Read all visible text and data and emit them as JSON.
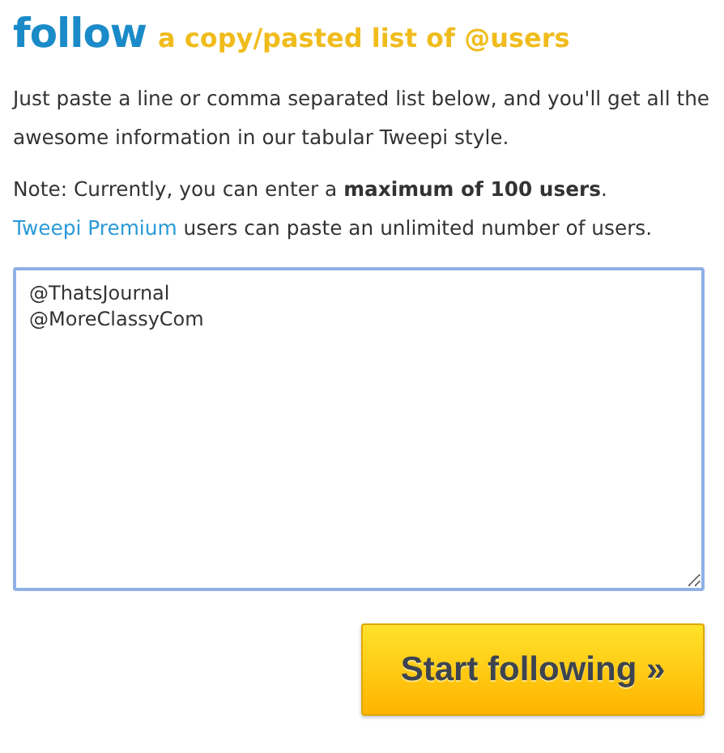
{
  "heading": {
    "main": "follow",
    "sub": "a copy/pasted list of @users"
  },
  "intro": "Just paste a line or comma separated list below, and you'll get all the awesome information in our tabular Tweepi style.",
  "note": {
    "before": "Note: Currently, you can enter a **maximum of 100 users**.",
    "link": "Tweepi Premium",
    "after": "users can paste an unlimited number of users."
  },
  "users_field": {
    "value": "@ThatsJournal\n@MoreClassyCom"
  },
  "submit_button": "Start following »"
}
